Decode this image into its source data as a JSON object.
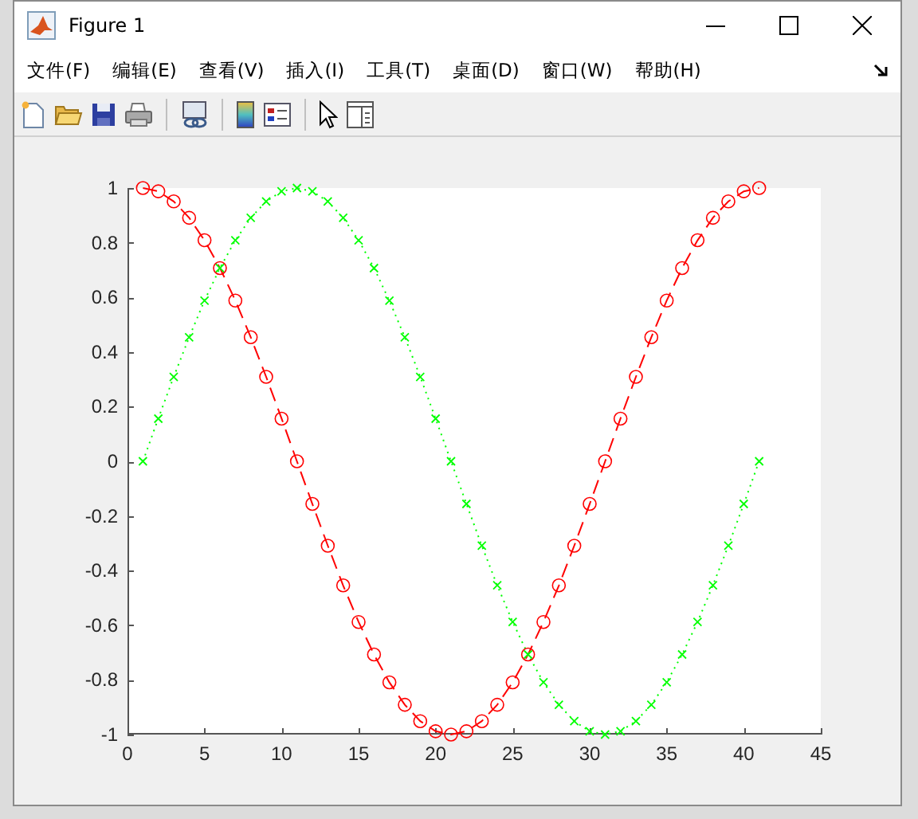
{
  "window": {
    "title": "Figure 1"
  },
  "menu": [
    "文件(F)",
    "编辑(E)",
    "查看(V)",
    "插入(I)",
    "工具(T)",
    "桌面(D)",
    "窗口(W)",
    "帮助(H)"
  ],
  "chart_data": {
    "type": "line",
    "x": [
      1,
      2,
      3,
      4,
      5,
      6,
      7,
      8,
      9,
      10,
      11,
      12,
      13,
      14,
      15,
      16,
      17,
      18,
      19,
      20,
      21,
      22,
      23,
      24,
      25,
      26,
      27,
      28,
      29,
      30,
      31,
      32,
      33,
      34,
      35,
      36,
      37,
      38,
      39,
      40,
      41
    ],
    "xlim": [
      0,
      45
    ],
    "ylim": [
      -1,
      1
    ],
    "xticks": [
      0,
      5,
      10,
      15,
      20,
      25,
      30,
      35,
      40,
      45
    ],
    "yticks": [
      -1,
      -0.8,
      -0.6,
      -0.4,
      -0.2,
      0,
      0.2,
      0.4,
      0.6,
      0.8,
      1
    ],
    "series": [
      {
        "color": "#ff0000",
        "line_style": "dashed",
        "marker": "circle",
        "values": [
          1,
          0.988,
          0.951,
          0.891,
          0.809,
          0.707,
          0.588,
          0.454,
          0.309,
          0.156,
          0,
          -0.156,
          -0.309,
          -0.454,
          -0.588,
          -0.707,
          -0.809,
          -0.891,
          -0.951,
          -0.988,
          -1,
          -0.988,
          -0.951,
          -0.891,
          -0.809,
          -0.707,
          -0.588,
          -0.454,
          -0.309,
          -0.156,
          0,
          0.156,
          0.309,
          0.454,
          0.588,
          0.707,
          0.809,
          0.891,
          0.951,
          0.988,
          1
        ]
      },
      {
        "color": "#00ff00",
        "line_style": "dotted",
        "marker": "x",
        "values": [
          0,
          0.156,
          0.309,
          0.454,
          0.588,
          0.707,
          0.809,
          0.891,
          0.951,
          0.988,
          1,
          0.988,
          0.951,
          0.891,
          0.809,
          0.707,
          0.588,
          0.454,
          0.309,
          0.156,
          0,
          -0.156,
          -0.309,
          -0.454,
          -0.588,
          -0.707,
          -0.809,
          -0.891,
          -0.951,
          -0.988,
          -1,
          -0.988,
          -0.951,
          -0.891,
          -0.809,
          -0.707,
          -0.588,
          -0.454,
          -0.309,
          -0.156,
          0
        ]
      }
    ]
  }
}
